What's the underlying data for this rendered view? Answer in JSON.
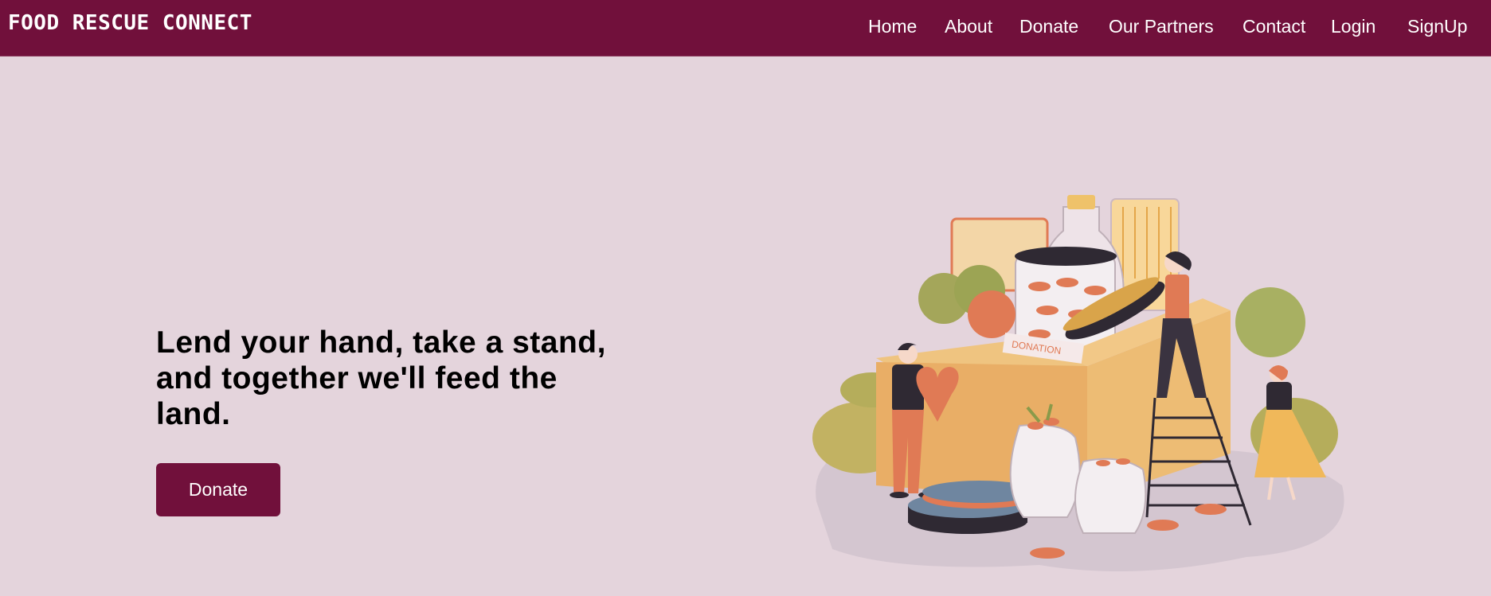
{
  "header": {
    "brand": "FOOD RESCUE CONNECT",
    "nav": {
      "home": "Home",
      "about": "About",
      "donate": "Donate",
      "partners": "Our Partners",
      "contact": "Contact",
      "login": "Login",
      "signup": "SignUp"
    }
  },
  "hero": {
    "heading": "Lend your hand, take a stand, and together we'll feed the land.",
    "cta_label": "Donate",
    "illustration": {
      "box_label": "DONATION",
      "icon": "food-donation-illustration"
    }
  },
  "colors": {
    "navbar": "#71103b",
    "background": "#e4d4dc",
    "button": "#71103b",
    "text": "#000000"
  }
}
